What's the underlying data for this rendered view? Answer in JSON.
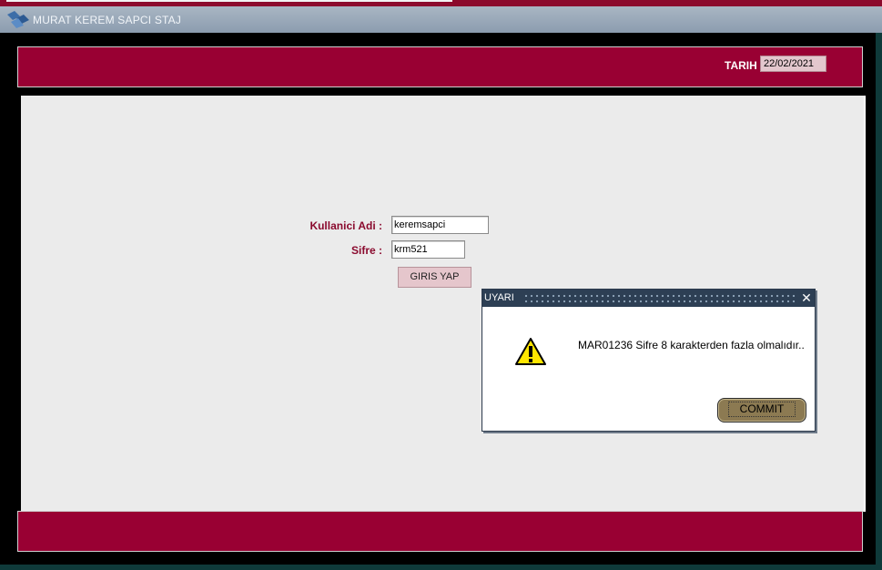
{
  "window": {
    "title": "MURAT KEREM SAPCI STAJ"
  },
  "header": {
    "date_label": "TARIH",
    "date_value": "22/02/2021"
  },
  "login_form": {
    "username_label": "Kullanici Adi :",
    "username_value": "keremsapci",
    "password_label": "Sifre :",
    "password_value": "krm521",
    "login_button_label": "GIRIS YAP"
  },
  "alert": {
    "title": "UYARI",
    "message": "MAR01236 Sifre 8 karakterden fazla olmalıdır..",
    "commit_button_label": "COMMIT",
    "icon": "warning-icon",
    "close_icon": "close-icon"
  },
  "colors": {
    "brand_band": "#990033",
    "content_background": "#ebebeb",
    "label_color": "#8a0a2e",
    "dialog_titlebar": "#2d3f54",
    "commit_button": "#8c7a52"
  }
}
